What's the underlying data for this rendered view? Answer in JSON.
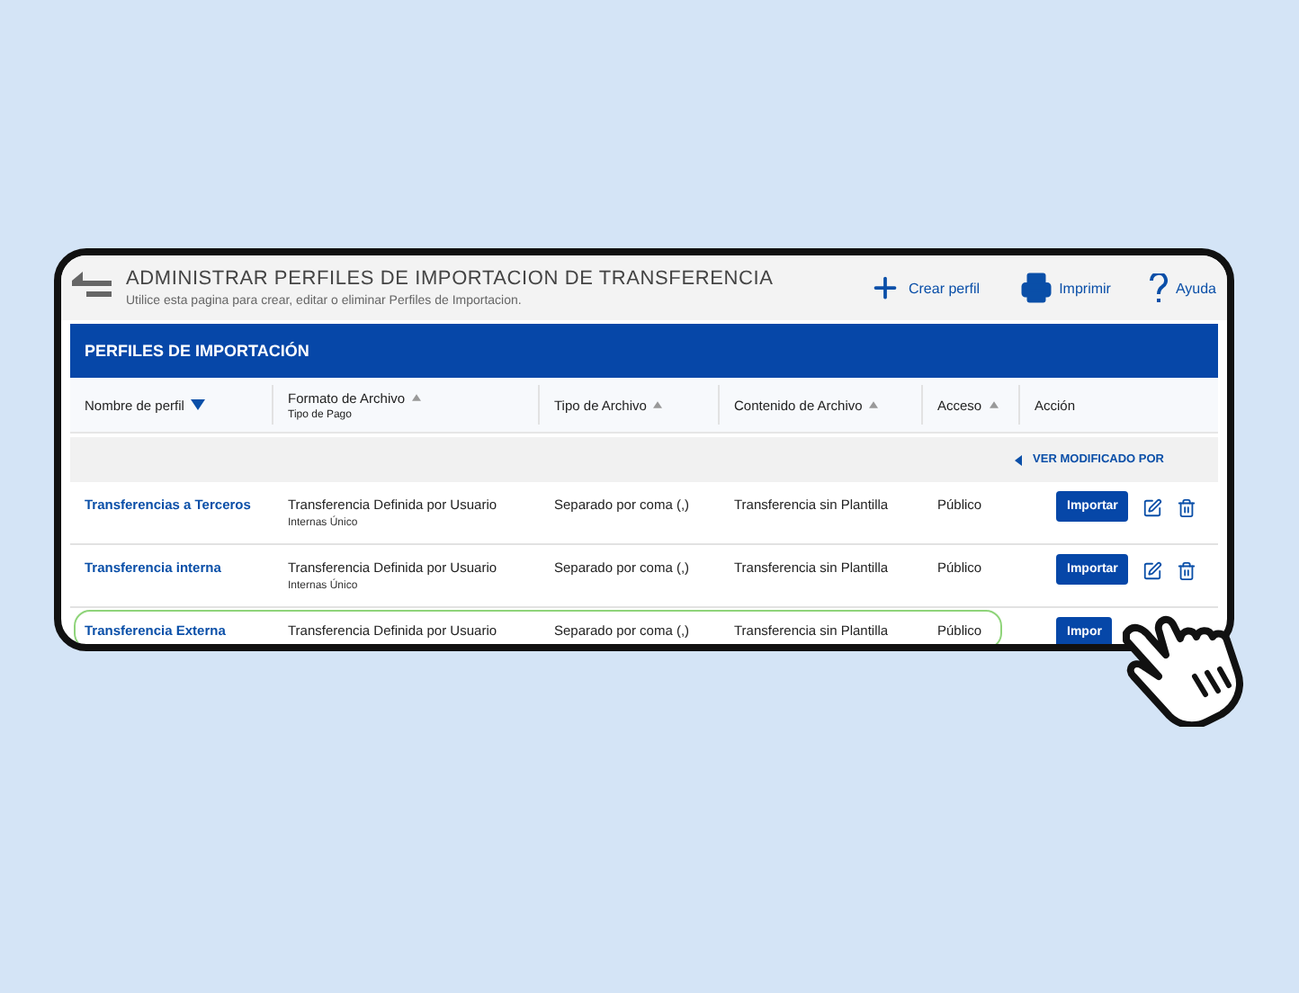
{
  "page": {
    "title": "ADMINISTRAR PERFILES DE IMPORTACION DE TRANSFERENCIA",
    "subtitle": "Utilice esta pagina para crear, editar o eliminar Perfiles de Importacion."
  },
  "actions": [
    {
      "kind": "plus",
      "label": "Crear perfil"
    },
    {
      "kind": "printer",
      "label": "Imprimir"
    },
    {
      "kind": "help",
      "label": "Ayuda"
    }
  ],
  "panel": {
    "title": "PERFILES DE IMPORTACIÓN",
    "columns": [
      {
        "label": "Nombre de perfil",
        "kind": "sortable",
        "selected": true
      },
      {
        "label": "Formato de Archivo",
        "sublabel": "Tipo de Pago",
        "kind": "sortable",
        "selected": false
      },
      {
        "label": "Tipo de Archivo",
        "kind": "sortable",
        "selected": false
      },
      {
        "label": "Contenido de Archivo",
        "kind": "sortable",
        "selected": false
      },
      {
        "label": "Acceso",
        "kind": "sortable",
        "selected": false
      },
      {
        "label": "Acción",
        "kind": "plain"
      }
    ],
    "toggle": "VER MODIFICADO POR",
    "rows": [
      {
        "name": "Transferencias a Terceros",
        "format": "Transferencia Definida por Usuario",
        "payment_type": "Internas Único",
        "file_type": "Separado por coma (,)",
        "content": "Transferencia sin Plantilla",
        "access": "Público",
        "button": "Importar",
        "tools": true,
        "highlighted": false
      },
      {
        "name": "Transferencia interna",
        "format": "Transferencia Definida por Usuario",
        "payment_type": "Internas Único",
        "file_type": "Separado por coma (,)",
        "content": "Transferencia sin Plantilla",
        "access": "Público",
        "button": "Importar",
        "tools": true,
        "highlighted": false
      },
      {
        "name": "Transferencia Externa",
        "format": "Transferencia Definida por Usuario",
        "file_type": "Separado por coma (,)",
        "content": "Transferencia sin Plantilla",
        "access": "Público",
        "button": "Impor",
        "tools": false,
        "highlighted": true
      }
    ]
  }
}
